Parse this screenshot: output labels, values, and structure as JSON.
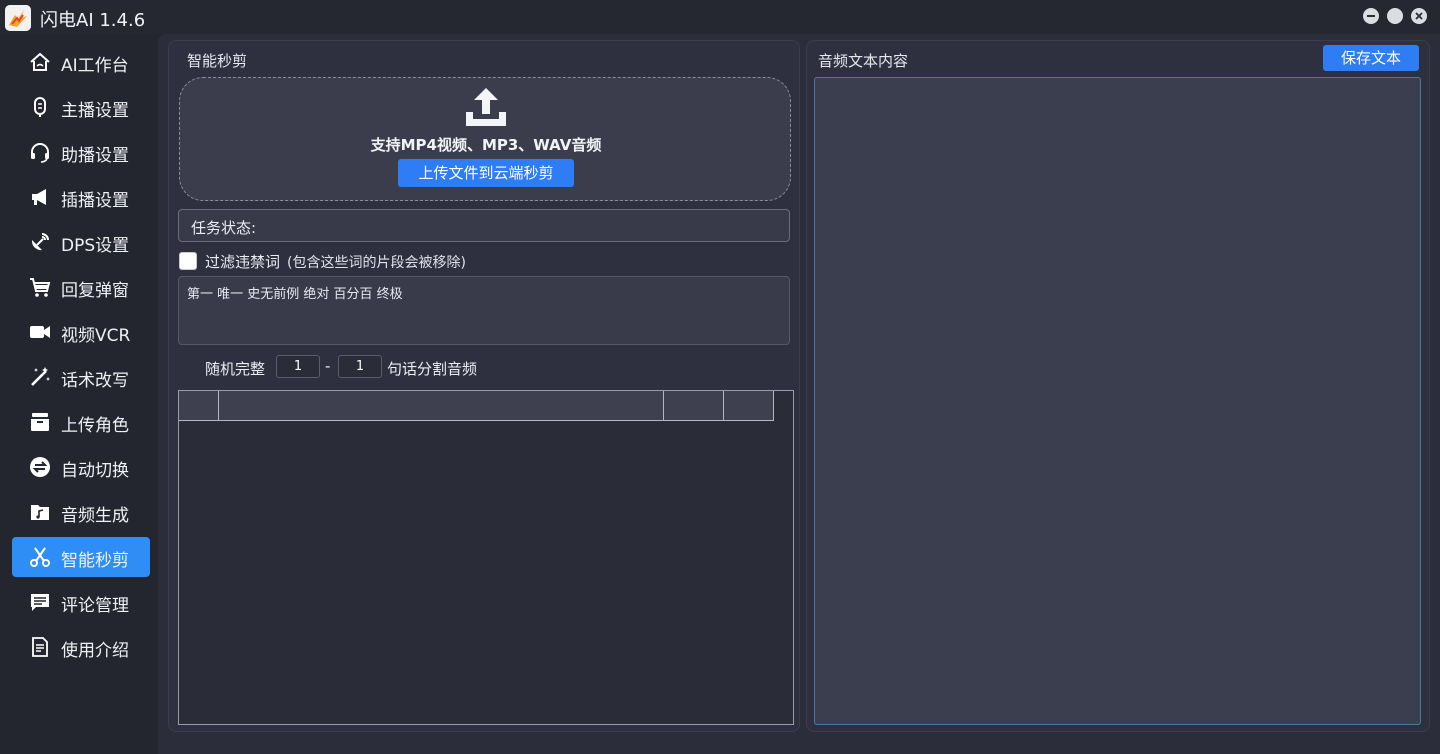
{
  "window": {
    "title": "闪电AI 1.4.6",
    "controls": [
      "minimize-icon",
      "maximize-icon",
      "close-icon"
    ]
  },
  "sidebar": {
    "items": [
      {
        "label": "AI工作台",
        "icon": "home-icon",
        "active": false
      },
      {
        "label": "主播设置",
        "icon": "microphone-icon",
        "active": false
      },
      {
        "label": "助播设置",
        "icon": "headset-icon",
        "active": false
      },
      {
        "label": "插播设置",
        "icon": "megaphone-icon",
        "active": false
      },
      {
        "label": "DPS设置",
        "icon": "satellite-icon",
        "active": false
      },
      {
        "label": "回复弹窗",
        "icon": "cart-icon",
        "active": false
      },
      {
        "label": "视频VCR",
        "icon": "video-camera-icon",
        "active": false
      },
      {
        "label": "话术改写",
        "icon": "magic-wand-icon",
        "active": false
      },
      {
        "label": "上传角色",
        "icon": "archive-box-icon",
        "active": false
      },
      {
        "label": "自动切换",
        "icon": "switch-arrows-icon",
        "active": false
      },
      {
        "label": "音频生成",
        "icon": "music-folder-icon",
        "active": false
      },
      {
        "label": "智能秒剪",
        "icon": "scissors-icon",
        "active": true
      },
      {
        "label": "评论管理",
        "icon": "comment-icon",
        "active": false
      },
      {
        "label": "使用介绍",
        "icon": "document-icon",
        "active": false
      }
    ]
  },
  "left_panel": {
    "title": "智能秒剪",
    "upload": {
      "hint": "支持MP4视频、MP3、WAV音频",
      "button_label": "上传文件到云端秒剪"
    },
    "status_label": "任务状态:",
    "filter": {
      "checked": false,
      "label": "过滤违禁词",
      "note": "(包含这些词的片段会被移除)",
      "words": "第一 唯一 史无前例 绝对 百分百 终极"
    },
    "split": {
      "prefix": "随机完整",
      "from": "1",
      "dash": "-",
      "to": "1",
      "suffix": "句话分割音频"
    },
    "table": {
      "columns": [
        "",
        "",
        "",
        ""
      ],
      "rows": []
    }
  },
  "right_panel": {
    "title": "音频文本内容",
    "save_label": "保存文本",
    "text_content": ""
  },
  "colors": {
    "accent": "#2f7df5",
    "active_nav": "#2e8ef5",
    "background": "#23252f",
    "panel": "#2e3040"
  }
}
